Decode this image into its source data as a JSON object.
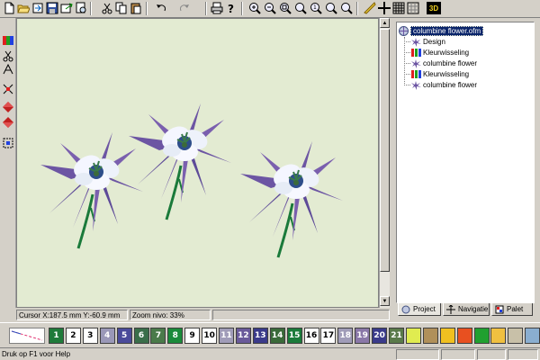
{
  "toolbar": {
    "buttons": [
      "new-file",
      "open-file",
      "import",
      "save",
      "export",
      "print-preview",
      "cut",
      "copy",
      "paste",
      "undo",
      "redo",
      "print",
      "help",
      "zoom-in",
      "zoom-out",
      "zoom-area",
      "zoom-fit",
      "zoom-one",
      "zoom-previous",
      "zoom-all",
      "measure",
      "crosshair",
      "grid",
      "hoop"
    ],
    "three_d_label": "3D"
  },
  "vtoolbar": {
    "tools": [
      "color-change-tool",
      "cut-tool",
      "stitch-tool",
      "align-tool",
      "move-up-tool",
      "move-down-tool",
      "select-tool"
    ]
  },
  "canvas": {
    "background": "#e3ebd2",
    "flowers": 3
  },
  "status": {
    "cursor": "Cursor X:187.5 mm Y:-60.9 mm",
    "zoom": "Zoom nivo: 33%"
  },
  "tree": {
    "root": "columbine flower.ofm",
    "children": [
      {
        "label": "Design",
        "icon": "design-icon"
      },
      {
        "label": "Kleurwisseling",
        "icon": "color-change-icon"
      },
      {
        "label": "columbine flower",
        "icon": "design-icon"
      },
      {
        "label": "Kleurwisseling",
        "icon": "color-change-icon"
      },
      {
        "label": "columbine flower",
        "icon": "design-icon"
      }
    ]
  },
  "tabs": [
    {
      "label": "Project",
      "icon": "project-icon",
      "active": true
    },
    {
      "label": "Navigatie",
      "icon": "navigate-icon",
      "active": false
    },
    {
      "label": "Palet",
      "icon": "palette-icon",
      "active": false
    }
  ],
  "palette": [
    {
      "num": "1",
      "color": "#1f7a3a",
      "text": "#fff"
    },
    {
      "num": "2",
      "color": "#ffffff",
      "text": "#000"
    },
    {
      "num": "3",
      "color": "#ffffff",
      "text": "#000"
    },
    {
      "num": "4",
      "color": "#9a98b8",
      "text": "#fff"
    },
    {
      "num": "5",
      "color": "#4a4a9a",
      "text": "#fff"
    },
    {
      "num": "6",
      "color": "#3a6e4a",
      "text": "#fff"
    },
    {
      "num": "7",
      "color": "#4a7a4a",
      "text": "#fff"
    },
    {
      "num": "8",
      "color": "#1a8a3a",
      "text": "#fff"
    },
    {
      "num": "9",
      "color": "#ffffff",
      "text": "#000"
    },
    {
      "num": "10",
      "color": "#ffffff",
      "text": "#000"
    },
    {
      "num": "11",
      "color": "#a09cb8",
      "text": "#fff"
    },
    {
      "num": "12",
      "color": "#6a5a9a",
      "text": "#fff"
    },
    {
      "num": "13",
      "color": "#3a3a8a",
      "text": "#fff"
    },
    {
      "num": "14",
      "color": "#3a6a3a",
      "text": "#fff"
    },
    {
      "num": "15",
      "color": "#1a7a3a",
      "text": "#fff"
    },
    {
      "num": "16",
      "color": "#ffffff",
      "text": "#000"
    },
    {
      "num": "17",
      "color": "#ffffff",
      "text": "#000"
    },
    {
      "num": "18",
      "color": "#a09cb8",
      "text": "#fff"
    },
    {
      "num": "19",
      "color": "#8a78a8",
      "text": "#fff"
    },
    {
      "num": "20",
      "color": "#3a3a8a",
      "text": "#fff"
    },
    {
      "num": "21",
      "color": "#5a7a4a",
      "text": "#fff"
    },
    {
      "num": "",
      "color": "#e0ec50",
      "text": "#000"
    },
    {
      "num": "",
      "color": "#b0905a",
      "text": "#000"
    },
    {
      "num": "",
      "color": "#f0c020",
      "text": "#000"
    },
    {
      "num": "",
      "color": "#e85020",
      "text": "#000"
    },
    {
      "num": "",
      "color": "#20a030",
      "text": "#000"
    },
    {
      "num": "",
      "color": "#f0c040",
      "text": "#000"
    },
    {
      "num": "",
      "color": "#c8c0a8",
      "text": "#000"
    },
    {
      "num": "",
      "color": "#8aaed0",
      "text": "#000"
    }
  ],
  "statusbar": {
    "help": "Druk op F1 voor Help"
  }
}
